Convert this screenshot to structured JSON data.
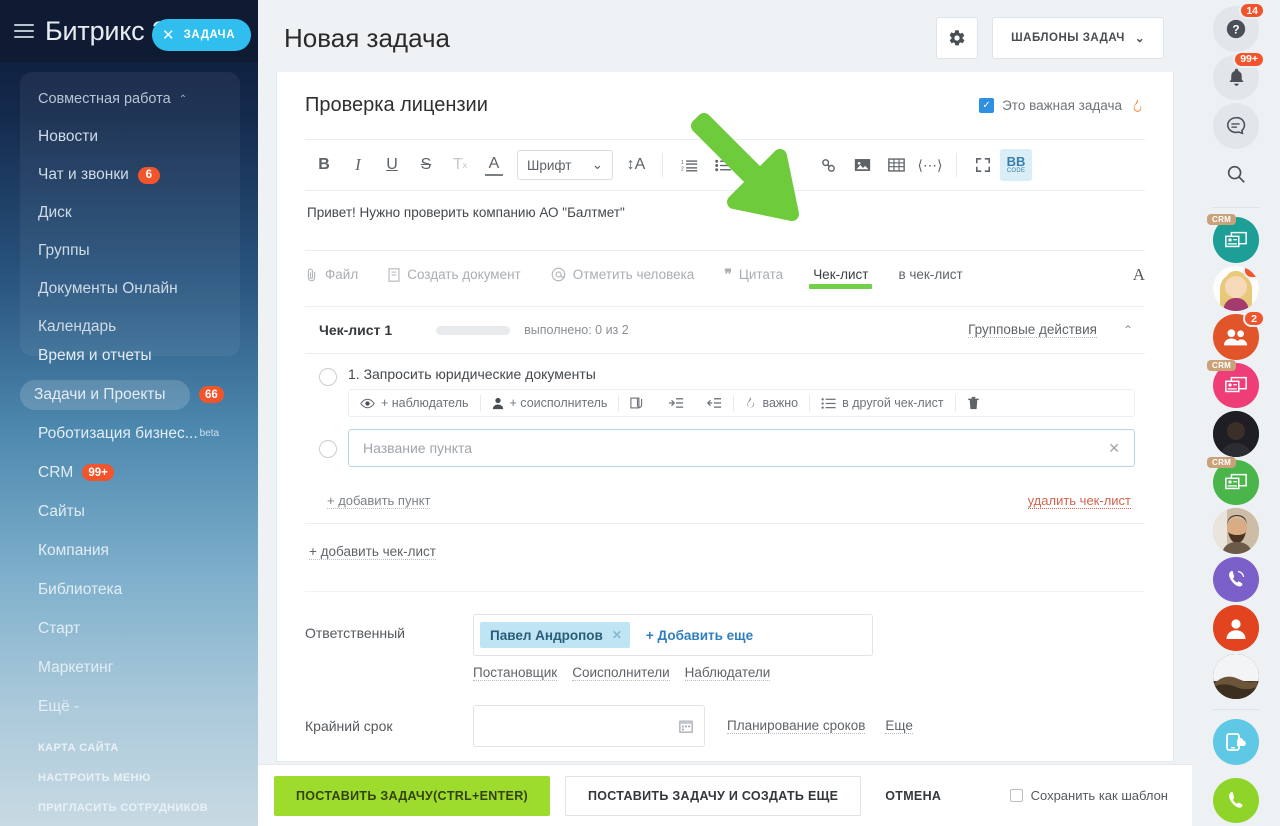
{
  "sidebar": {
    "logo": "Битрикс 24",
    "task_tab": {
      "label": "ЗАДАЧА",
      "close": "✕"
    },
    "group": {
      "head": "Совместная работа",
      "items": [
        {
          "label": "Новости",
          "badge": ""
        },
        {
          "label": "Чат и звонки",
          "badge": "6"
        },
        {
          "label": "Диск",
          "badge": ""
        },
        {
          "label": "Группы",
          "badge": ""
        },
        {
          "label": "Документы Онлайн",
          "badge": ""
        },
        {
          "label": "Календарь",
          "badge": ""
        }
      ]
    },
    "items": [
      {
        "label": "Время и отчеты",
        "badge": "",
        "beta": "",
        "active": false
      },
      {
        "label": "Задачи и Проекты",
        "badge": "66",
        "beta": "",
        "active": true
      },
      {
        "label": "Роботизация бизнес...",
        "badge": "",
        "beta": "beta",
        "active": false
      },
      {
        "label": "CRM",
        "badge": "99+",
        "beta": "",
        "active": false
      },
      {
        "label": "Сайты",
        "badge": "",
        "beta": "",
        "active": false
      },
      {
        "label": "Компания",
        "badge": "",
        "beta": "",
        "active": false
      },
      {
        "label": "Библиотека",
        "badge": "",
        "beta": "",
        "active": false
      },
      {
        "label": "Старт",
        "badge": "",
        "beta": "",
        "active": false
      },
      {
        "label": "Маркетинг",
        "badge": "",
        "beta": "",
        "active": false
      },
      {
        "label": "Ещё -",
        "badge": "",
        "beta": "",
        "active": false
      }
    ],
    "footer": [
      "КАРТА САЙТА",
      "НАСТРОИТЬ МЕНЮ",
      "ПРИГЛАСИТЬ СОТРУДНИКОВ"
    ]
  },
  "header": {
    "title": "Новая задача",
    "gear_icon": "gear-icon",
    "templates_button": "ШАБЛОНЫ ЗАДАЧ",
    "templates_chevron": "⌄"
  },
  "task": {
    "name": "Проверка лицензии",
    "important_label": "Это важная задача",
    "important_checked": true,
    "flame_icon": "flame-icon"
  },
  "toolbar": {
    "bold": "B",
    "italic": "I",
    "underline": "U",
    "strike": "S",
    "clear_format": "Tx",
    "text_color": "A",
    "font_label": "Шрифт",
    "font_chevron": "⌄",
    "line_height": "↕A",
    "ordered_list": "ordered-list-icon",
    "bullet_list": "bullet-list-icon",
    "link": "link-icon",
    "image": "image-icon",
    "table": "table-icon",
    "code": "⟨⋯⟩",
    "fullscreen": "fullscreen-icon",
    "bb_label": "BB",
    "bb_sub": "CODE"
  },
  "editor": {
    "text": "Привет! Нужно проверить компанию АО \"Балтмет\""
  },
  "attach_row": {
    "items": [
      {
        "label": "Файл",
        "icon": "paperclip-icon",
        "state": "dim"
      },
      {
        "label": "Создать документ",
        "icon": "document-icon",
        "state": "dim"
      },
      {
        "label": "Отметить человека",
        "icon": "at-icon",
        "state": "dim"
      },
      {
        "label": "Цитата",
        "icon": "quote-icon",
        "state": "dim"
      },
      {
        "label": "Чек-лист",
        "icon": "",
        "state": "active"
      },
      {
        "label": "в чек-лист",
        "icon": "",
        "state": "dark"
      }
    ],
    "right_icon": "A"
  },
  "checklist": {
    "title": "Чек-лист 1",
    "progress": "выполнено: 0 из 2",
    "group_actions": "Групповые действия",
    "collapse_chevron": "⌃",
    "item": {
      "text": "1. Запросить юридические документы",
      "actions": [
        {
          "label": "+ наблюдатель",
          "icon": "eye-icon"
        },
        {
          "label": "+ соисполнитель",
          "icon": "person-icon"
        },
        {
          "label": "",
          "icon": "attach-copy-icon"
        },
        {
          "label": "",
          "icon": "indent-right-icon"
        },
        {
          "label": "",
          "icon": "indent-left-icon"
        },
        {
          "label": "важно",
          "icon": "flame-icon"
        },
        {
          "label": "в другой чек-лист",
          "icon": "list-icon"
        },
        {
          "label": "",
          "icon": "trash-icon"
        }
      ]
    },
    "input_placeholder": "Название пункта",
    "input_clear": "✕",
    "add_item": "+ добавить пункт",
    "delete_checklist": "удалить чек-лист",
    "add_checklist": "+ добавить чек-лист"
  },
  "responsible": {
    "label": "Ответственный",
    "chip": "Павел Андропов",
    "chip_close": "✕",
    "add_more": "+ Добавить еще",
    "links": [
      "Постановщик",
      "Соисполнители",
      "Наблюдатели"
    ]
  },
  "deadline": {
    "label": "Крайний срок",
    "value": "",
    "calendar_icon": "calendar-icon",
    "links": [
      "Планирование сроков",
      "Еще"
    ]
  },
  "bottom_bar": {
    "submit": "ПОСТАВИТЬ ЗАДАЧУ(CTRL+ENTER)",
    "submit_more": "ПОСТАВИТЬ ЗАДАЧУ И СОЗДАТЬ ЕЩЕ",
    "cancel": "ОТМЕНА",
    "save_template": "Сохранить как шаблон",
    "save_template_checked": false
  },
  "rail": [
    {
      "name": "help-icon",
      "badge": "14",
      "kind": "grey",
      "glyph": "?"
    },
    {
      "name": "bell-icon",
      "badge": "99+",
      "kind": "grey",
      "glyph": "bell"
    },
    {
      "name": "chat-icon",
      "badge": "",
      "kind": "grey",
      "glyph": "chat"
    },
    {
      "name": "search-icon",
      "badge": "",
      "kind": "plain",
      "glyph": "search"
    },
    {
      "name": "crm-teal-icon",
      "badge": "",
      "kind": "crm",
      "color": "#1d9e97"
    },
    {
      "name": "avatar-woman",
      "badge": "4",
      "kind": "avatar",
      "color": "#f0c674"
    },
    {
      "name": "group-chat-icon",
      "badge": "2",
      "kind": "solid",
      "color": "#e2542a"
    },
    {
      "name": "crm-pink-icon",
      "badge": "",
      "kind": "crm",
      "color": "#ef3d77"
    },
    {
      "name": "avatar-dark",
      "badge": "",
      "kind": "avatar",
      "color": "#2b2b30"
    },
    {
      "name": "crm-green-icon",
      "badge": "",
      "kind": "crm",
      "color": "#4ab54a"
    },
    {
      "name": "avatar-beard",
      "badge": "",
      "kind": "avatar",
      "color": "#8c6b52"
    },
    {
      "name": "viber-icon",
      "badge": "",
      "kind": "solid",
      "color": "#7b60c9"
    },
    {
      "name": "contact-icon",
      "badge": "",
      "kind": "solid",
      "color": "#e2441f"
    },
    {
      "name": "avatar-photo",
      "badge": "",
      "kind": "avatar",
      "color": "#4a3b2a"
    },
    {
      "name": "openline-icon",
      "badge": "",
      "kind": "solid",
      "color": "#5ec8e5"
    },
    {
      "name": "call-icon",
      "badge": "",
      "kind": "solid",
      "color": "#8ed429"
    }
  ],
  "colors": {
    "accent_green": "#6ECB3C",
    "submit_green": "#9ddb2d",
    "badge_red": "#f2552c",
    "tab_blue": "#2fbeee",
    "chip_blue": "#bfe5f5"
  }
}
